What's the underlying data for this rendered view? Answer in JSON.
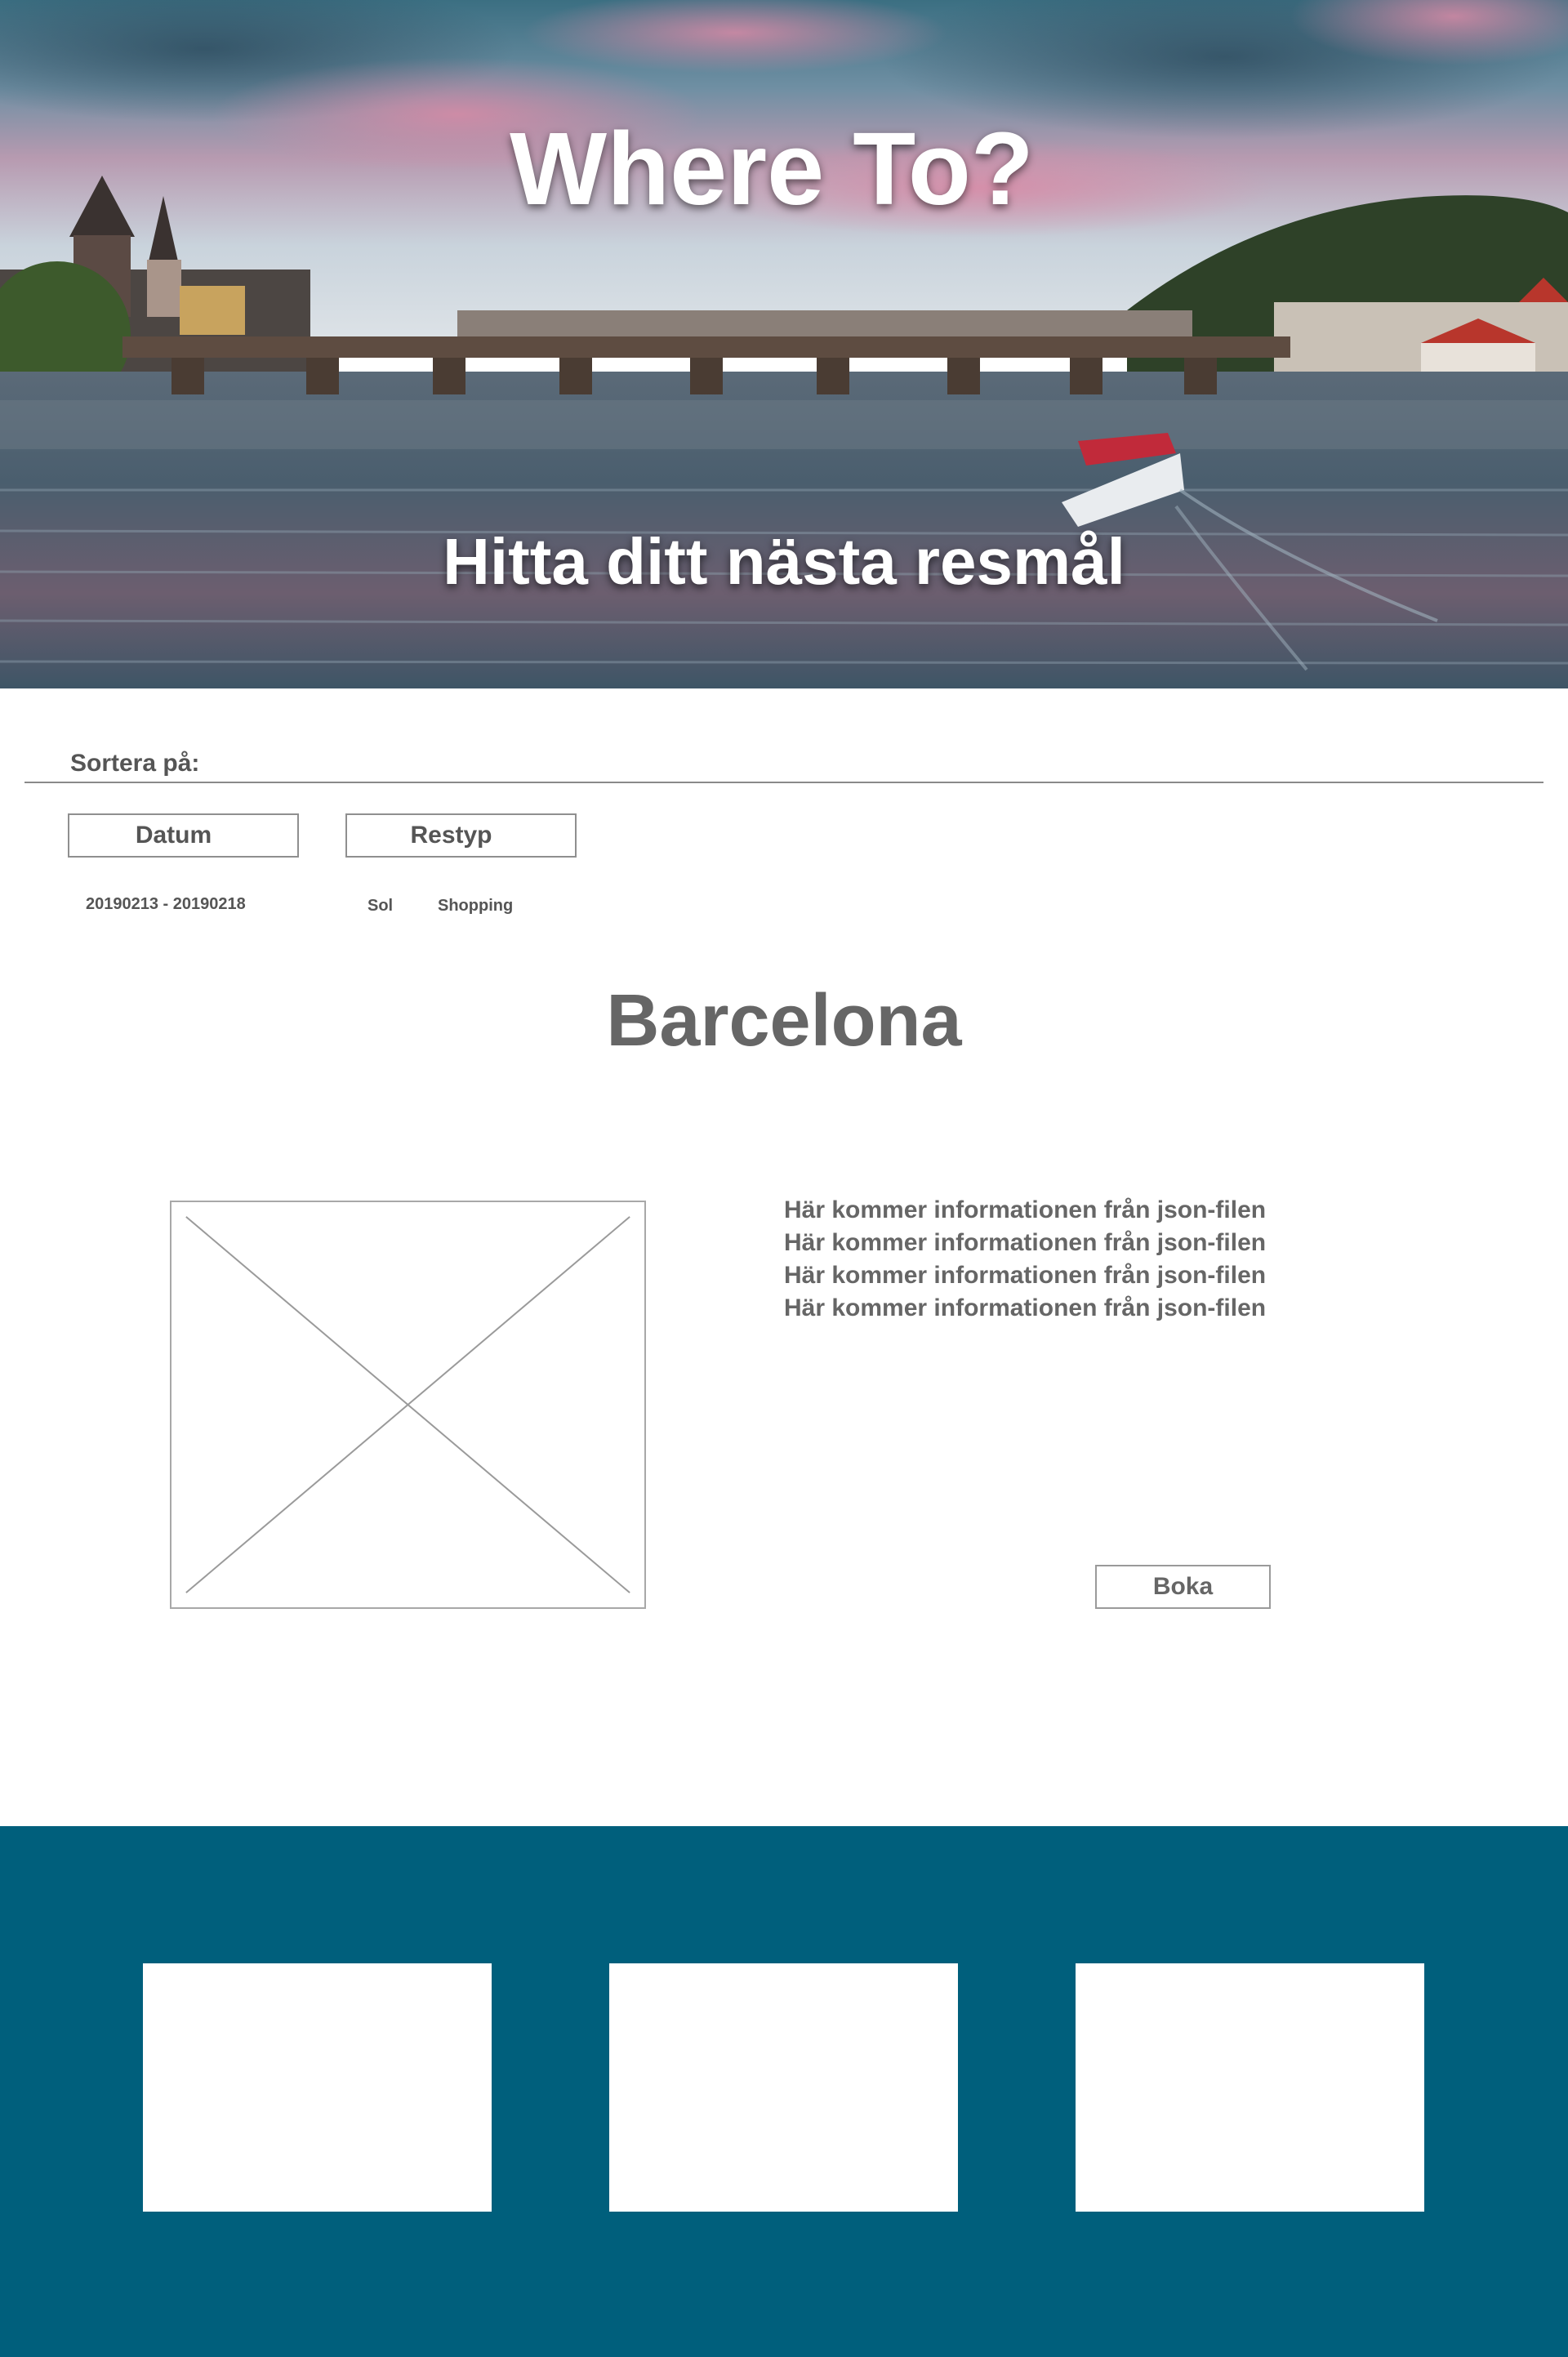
{
  "hero": {
    "title": "Where To?",
    "subtitle": "Hitta ditt nästa resmål",
    "image": "river-bridge-photo"
  },
  "sort": {
    "label": "Sortera på:",
    "buttons": [
      {
        "label": "Datum"
      },
      {
        "label": "Restyp"
      }
    ],
    "values": {
      "date_range": "20190213 - 20190218",
      "types": [
        "Sol",
        "Shopping"
      ]
    }
  },
  "destination": {
    "title": "Barcelona",
    "image": "image-placeholder-icon",
    "info_lines": [
      "Här kommer informationen från json-filen",
      "Här kommer informationen från json-filen",
      "Här kommer informationen från json-filen",
      "Här kommer informationen från json-filen"
    ],
    "book_label": "Boka"
  },
  "footer": {
    "background": "#005f7c",
    "cards": 3
  },
  "colors": {
    "text_gray": "#555555",
    "border_gray": "#8f8f8f",
    "footer_blue": "#005f7c"
  }
}
